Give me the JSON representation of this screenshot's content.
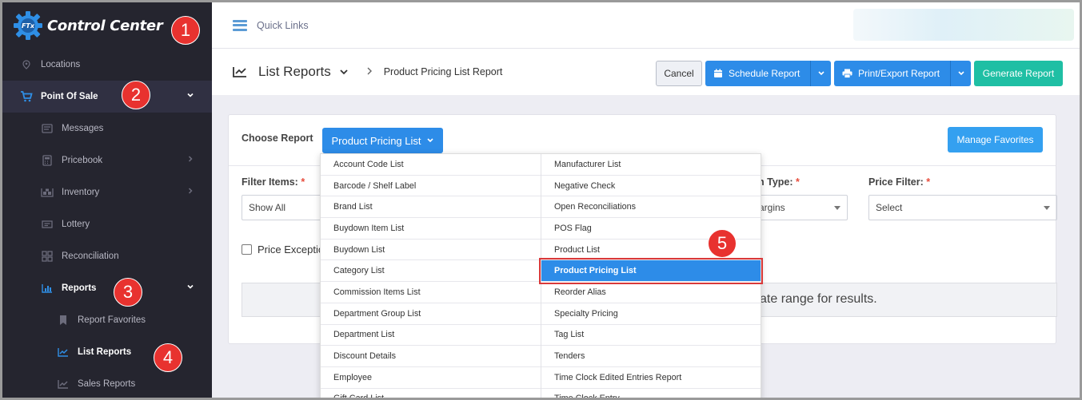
{
  "app": {
    "name": "Control Center",
    "logo_badge": "FTx"
  },
  "badges": [
    "1",
    "2",
    "3",
    "4",
    "5"
  ],
  "sidebar": {
    "items": [
      {
        "label": "Locations",
        "icon": "location-pin-icon"
      },
      {
        "label": "Point Of Sale",
        "icon": "cart-icon"
      },
      {
        "label": "Messages",
        "icon": "message-icon"
      },
      {
        "label": "Pricebook",
        "icon": "calculator-icon"
      },
      {
        "label": "Inventory",
        "icon": "inventory-icon"
      },
      {
        "label": "Lottery",
        "icon": "lottery-icon"
      },
      {
        "label": "Reconciliation",
        "icon": "grid-icon"
      },
      {
        "label": "Reports",
        "icon": "bar-chart-icon"
      },
      {
        "label": "Report Favorites",
        "icon": "bookmark-icon"
      },
      {
        "label": "List Reports",
        "icon": "line-chart-icon"
      },
      {
        "label": "Sales Reports",
        "icon": "line-chart-icon"
      }
    ]
  },
  "topbar": {
    "quick_links": "Quick Links"
  },
  "header": {
    "title": "List Reports",
    "breadcrumb": "Product Pricing List Report",
    "cancel": "Cancel",
    "schedule": "Schedule Report",
    "print_export": "Print/Export Report",
    "generate": "Generate Report"
  },
  "card": {
    "choose_label": "Choose Report",
    "choose_value": "Product Pricing List",
    "manage_favorites": "Manage Favorites",
    "filter_items_label": "Filter Items:",
    "filter_items_value": "Show All",
    "type_label": "n Type:",
    "type_value": "argins",
    "price_filter_label": "Price Filter:",
    "price_filter_value": "Select",
    "required_mark": "*",
    "price_exceptions_label": "Price Exceptio",
    "info_text": "ate range for results."
  },
  "dropdown": {
    "left": [
      "Account Code List",
      "Barcode / Shelf Label",
      "Brand List",
      "Buydown Item List",
      "Buydown List",
      "Category List",
      "Commission Items List",
      "Department Group List",
      "Department List",
      "Discount Details",
      "Employee",
      "Gift Card List"
    ],
    "right": [
      "Manufacturer List",
      "Negative Check",
      "Open Reconciliations",
      "POS Flag",
      "Product List",
      "Product Pricing List",
      "Reorder Alias",
      "Specialty Pricing",
      "Tag List",
      "Tenders",
      "Time Clock Edited Entries Report",
      "Time Clock Entry"
    ],
    "selected": "Product Pricing List"
  },
  "colors": {
    "primary": "#2d8ce8",
    "teal": "#1fbfa4",
    "sidebar": "#25252f",
    "badge": "#e8322f"
  }
}
